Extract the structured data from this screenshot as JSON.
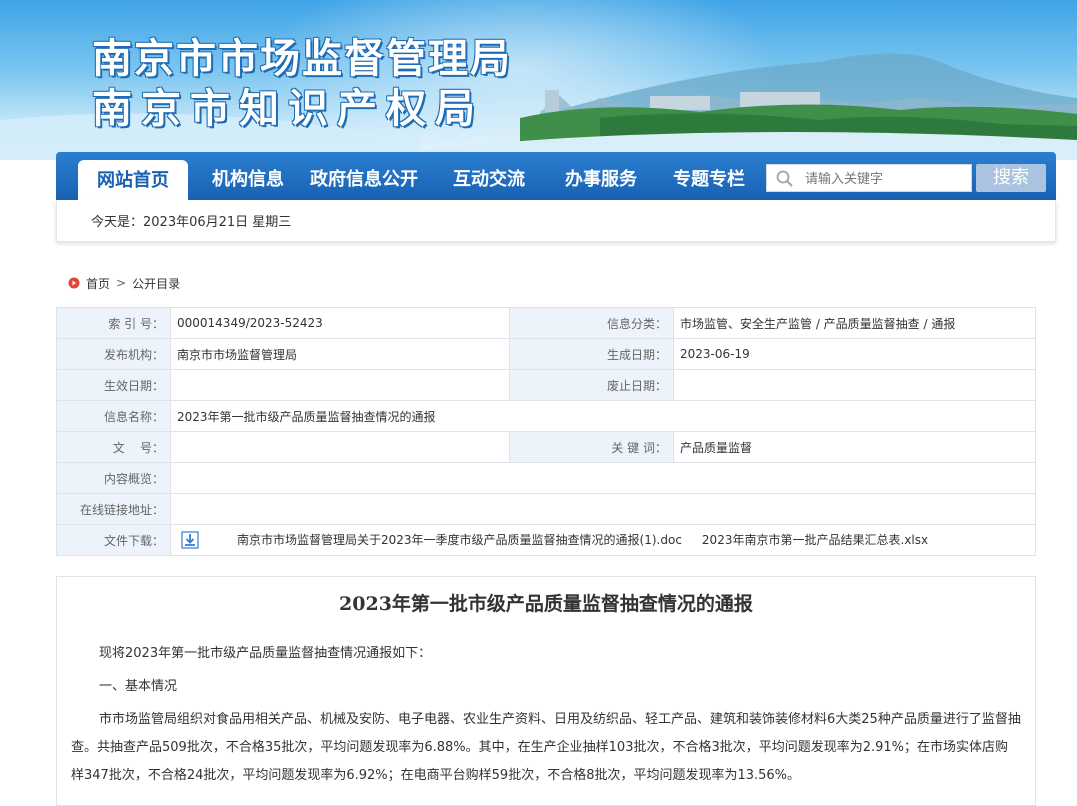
{
  "header": {
    "title_line1": "南京市市场监督管理局",
    "title_line2": "南京市知识产权局"
  },
  "nav": {
    "items": [
      {
        "label": "网站首页",
        "active": true
      },
      {
        "label": "机构信息"
      },
      {
        "label": "政府信息公开"
      },
      {
        "label": "互动交流"
      },
      {
        "label": "办事服务"
      },
      {
        "label": "专题专栏"
      }
    ],
    "search_placeholder": "请输入关键字",
    "search_button": "搜索"
  },
  "date_text": "今天是：2023年06月21日  星期三",
  "breadcrumb": {
    "home": "首页",
    "current": "公开目录"
  },
  "meta": {
    "index_label": "索 引 号：",
    "index_value": "000014349/2023-52423",
    "category_label": "信息分类：",
    "category_value": "市场监管、安全生产监管 / 产品质量监督抽查 / 通报",
    "publisher_label": "发布机构：",
    "publisher_value": "南京市市场监督管理局",
    "created_label": "生成日期：",
    "created_value": "2023-06-19",
    "effective_label": "生效日期：",
    "effective_value": "",
    "abolish_label": "废止日期：",
    "abolish_value": "",
    "name_label": "信息名称：",
    "name_value": "2023年第一批市级产品质量监督抽查情况的通报",
    "docno_label": "文    号：",
    "docno_value": "",
    "keywords_label": "关 键 词：",
    "keywords_value": "产品质量监督",
    "summary_label": "内容概览：",
    "summary_value": "",
    "link_label": "在线链接地址：",
    "link_value": "",
    "download_label": "文件下载：",
    "download_file1": "南京市市场监督管理局关于2023年一季度市级产品质量监督抽查情况的通报(1).doc",
    "download_file2": "2023年南京市第一批产品结果汇总表.xlsx"
  },
  "article": {
    "title": "2023年第一批市级产品质量监督抽查情况的通报",
    "intro": "现将2023年第一批市级产品质量监督抽查情况通报如下：",
    "section1": "一、基本情况",
    "body": "市市场监管局组织对食品用相关产品、机械及安防、电子电器、农业生产资料、日用及纺织品、轻工产品、建筑和装饰装修材料6大类25种产品质量进行了监督抽查。共抽查产品509批次，不合格35批次，平均问题发现率为6.88%。其中，在生产企业抽样103批次，不合格3批次，平均问题发现率为2.91%；在市场实体店购样347批次，不合格24批次，平均问题发现率为6.92%；在电商平台购样59批次，不合格8批次，平均问题发现率为13.56%。"
  }
}
